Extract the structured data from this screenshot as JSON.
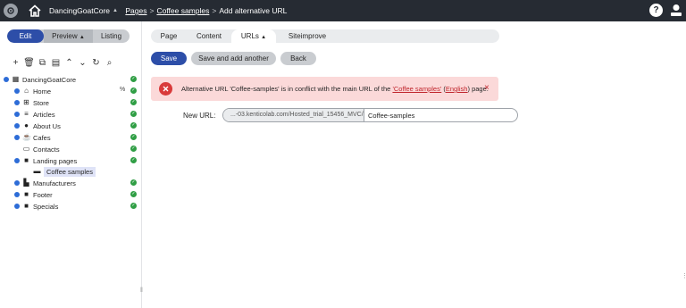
{
  "topbar": {
    "site_name": "DancingGoatCore",
    "crumb_pages": "Pages",
    "crumb_page": "Coffee samples",
    "crumb_current": "Add alternative URL",
    "help_label": "?"
  },
  "modes": {
    "edit": "Edit",
    "preview": "Preview",
    "listing": "Listing"
  },
  "tree": {
    "items": [
      {
        "label": "DancingGoatCore"
      },
      {
        "label": "Home"
      },
      {
        "label": "Store"
      },
      {
        "label": "Articles"
      },
      {
        "label": "About Us"
      },
      {
        "label": "Cafes"
      },
      {
        "label": "Contacts"
      },
      {
        "label": "Landing pages"
      },
      {
        "label": "Coffee samples"
      },
      {
        "label": "Manufacturers"
      },
      {
        "label": "Footer"
      },
      {
        "label": "Specials"
      }
    ]
  },
  "tabs": {
    "page": "Page",
    "content": "Content",
    "urls": "URLs",
    "siteimprove": "Siteimprove"
  },
  "actions": {
    "save": "Save",
    "save_add": "Save and add another",
    "back": "Back"
  },
  "alert": {
    "text_before": "Alternative URL 'Coffee-samples' is in conflict with the main URL of the ",
    "link_page": "'Coffee samples'",
    "text_mid": " (",
    "link_culture": "English",
    "text_after": ") page.",
    "close": "×"
  },
  "form": {
    "new_url_label": "New URL:",
    "url_prefix": "...-03.kenticolab.com/Hosted_trial_15456_MVC/",
    "url_value": "Coffee-samples"
  },
  "colors": {
    "primary": "#2d4ea8",
    "topbar": "#262b33",
    "alert_bg": "#fbd9d9",
    "alert_red": "#d93a3a",
    "ok_green": "#2f9e44"
  }
}
